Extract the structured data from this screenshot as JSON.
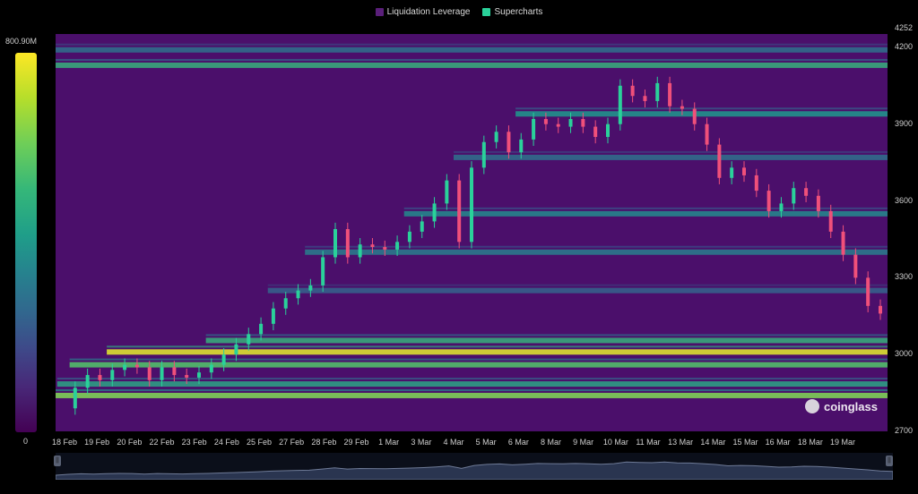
{
  "legend": [
    {
      "label": "Liquidation Leverage",
      "color": "#5a1f7a"
    },
    {
      "label": "Supercharts",
      "color": "#2ad19a"
    }
  ],
  "colorbar": {
    "max_label": "800.90M",
    "min_label": "0"
  },
  "watermark": "coinglass",
  "chart_data": {
    "type": "heatmap",
    "y_axis": {
      "ticks": [
        "4252",
        "4200",
        "3900",
        "3600",
        "3300",
        "3000",
        "2700"
      ],
      "range": [
        2700,
        4252
      ]
    },
    "x_axis": {
      "ticks": [
        "18 Feb",
        "19 Feb",
        "20 Feb",
        "22 Feb",
        "23 Feb",
        "24 Feb",
        "25 Feb",
        "27 Feb",
        "28 Feb",
        "29 Feb",
        "1 Mar",
        "3 Mar",
        "4 Mar",
        "5 Mar",
        "6 Mar",
        "8 Mar",
        "9 Mar",
        "10 Mar",
        "11 Mar",
        "13 Mar",
        "14 Mar",
        "15 Mar",
        "16 Mar",
        "18 Mar",
        "19 Mar"
      ]
    },
    "colorscale": {
      "min": 0,
      "max": 800900000,
      "unit": "USD"
    },
    "price_series": {
      "name": "Supercharts",
      "points": [
        [
          0,
          2790
        ],
        [
          1,
          2870
        ],
        [
          2,
          2920
        ],
        [
          3,
          2900
        ],
        [
          4,
          2940
        ],
        [
          5,
          2960
        ],
        [
          6,
          2950
        ],
        [
          7,
          2900
        ],
        [
          8,
          2950
        ],
        [
          9,
          2920
        ],
        [
          10,
          2910
        ],
        [
          11,
          2930
        ],
        [
          12,
          2960
        ],
        [
          13,
          3000
        ],
        [
          14,
          3040
        ],
        [
          15,
          3080
        ],
        [
          16,
          3120
        ],
        [
          17,
          3180
        ],
        [
          18,
          3220
        ],
        [
          19,
          3250
        ],
        [
          20,
          3270
        ],
        [
          21,
          3380
        ],
        [
          22,
          3490
        ],
        [
          23,
          3380
        ],
        [
          24,
          3430
        ],
        [
          25,
          3420
        ],
        [
          26,
          3410
        ],
        [
          27,
          3440
        ],
        [
          28,
          3480
        ],
        [
          29,
          3520
        ],
        [
          30,
          3590
        ],
        [
          31,
          3680
        ],
        [
          32,
          3440
        ],
        [
          33,
          3730
        ],
        [
          34,
          3830
        ],
        [
          35,
          3870
        ],
        [
          36,
          3790
        ],
        [
          37,
          3840
        ],
        [
          38,
          3920
        ],
        [
          39,
          3900
        ],
        [
          40,
          3890
        ],
        [
          41,
          3920
        ],
        [
          42,
          3890
        ],
        [
          43,
          3850
        ],
        [
          44,
          3900
        ],
        [
          45,
          4050
        ],
        [
          46,
          4010
        ],
        [
          47,
          3990
        ],
        [
          48,
          4060
        ],
        [
          49,
          3970
        ],
        [
          50,
          3960
        ],
        [
          51,
          3900
        ],
        [
          52,
          3820
        ],
        [
          53,
          3690
        ],
        [
          54,
          3730
        ],
        [
          55,
          3700
        ],
        [
          56,
          3640
        ],
        [
          57,
          3560
        ],
        [
          58,
          3590
        ],
        [
          59,
          3650
        ],
        [
          60,
          3620
        ],
        [
          61,
          3560
        ],
        [
          62,
          3480
        ],
        [
          63,
          3390
        ],
        [
          64,
          3300
        ],
        [
          65,
          3190
        ],
        [
          66,
          3160
        ]
      ]
    },
    "liquidation_bands": [
      {
        "price": 2840,
        "level": 0.8
      },
      {
        "price": 2885,
        "level": 0.55
      },
      {
        "price": 2960,
        "level": 0.7
      },
      {
        "price": 3010,
        "level": 0.95
      },
      {
        "price": 3055,
        "level": 0.6
      },
      {
        "price": 3250,
        "level": 0.3
      },
      {
        "price": 3400,
        "level": 0.4
      },
      {
        "price": 3550,
        "level": 0.45
      },
      {
        "price": 3770,
        "level": 0.35
      },
      {
        "price": 3940,
        "level": 0.5
      },
      {
        "price": 4130,
        "level": 0.6
      },
      {
        "price": 4190,
        "level": 0.35
      }
    ]
  }
}
